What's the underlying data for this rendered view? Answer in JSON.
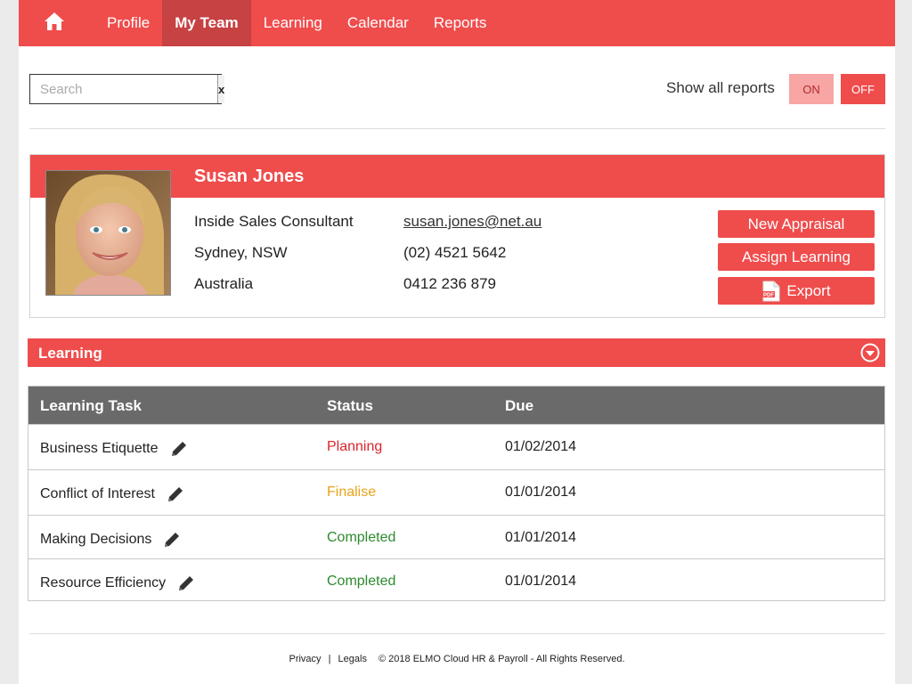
{
  "nav": {
    "home_icon": "home-icon",
    "items": [
      {
        "label": "Profile"
      },
      {
        "label": "My Team"
      },
      {
        "label": "Learning"
      },
      {
        "label": "Calendar"
      },
      {
        "label": "Reports"
      }
    ],
    "active_index": 1
  },
  "search": {
    "placeholder": "Search",
    "value": "",
    "clear_label": "x"
  },
  "reports_toggle": {
    "label": "Show all reports",
    "on_label": "ON",
    "off_label": "OFF",
    "selected": "OFF"
  },
  "profile": {
    "name": "Susan Jones",
    "title": "Inside Sales Consultant",
    "city": "Sydney, NSW",
    "country": "Australia",
    "email": "susan.jones@net.au",
    "phone": "(02) 4521 5642",
    "mobile": "0412 236 879",
    "actions": {
      "new_appraisal": "New Appraisal",
      "assign_learning": "Assign Learning",
      "export": "Export"
    }
  },
  "learning": {
    "section_title": "Learning",
    "columns": {
      "task": "Learning Task",
      "status": "Status",
      "due": "Due"
    },
    "rows": [
      {
        "task": "Business Etiquette",
        "status": "Planning",
        "due": "01/02/2014"
      },
      {
        "task": "Conflict of Interest",
        "status": "Finalise",
        "due": "01/01/2014"
      },
      {
        "task": "Making Decisions",
        "status": "Completed",
        "due": "01/01/2014"
      },
      {
        "task": "Resource Efficiency",
        "status": "Completed",
        "due": "01/01/2014"
      }
    ]
  },
  "footer": {
    "privacy": "Privacy",
    "separator": "|",
    "legals": "Legals",
    "copyright": "© 2018 ELMO Cloud HR & Payroll - All Rights Reserved."
  },
  "colors": {
    "accent": "#ef4c4c",
    "nav_active": "#c64243",
    "table_header": "#6a6a6a",
    "status_planning": "#d9262c",
    "status_finalise": "#e8a318",
    "status_completed": "#2d8a2d"
  }
}
